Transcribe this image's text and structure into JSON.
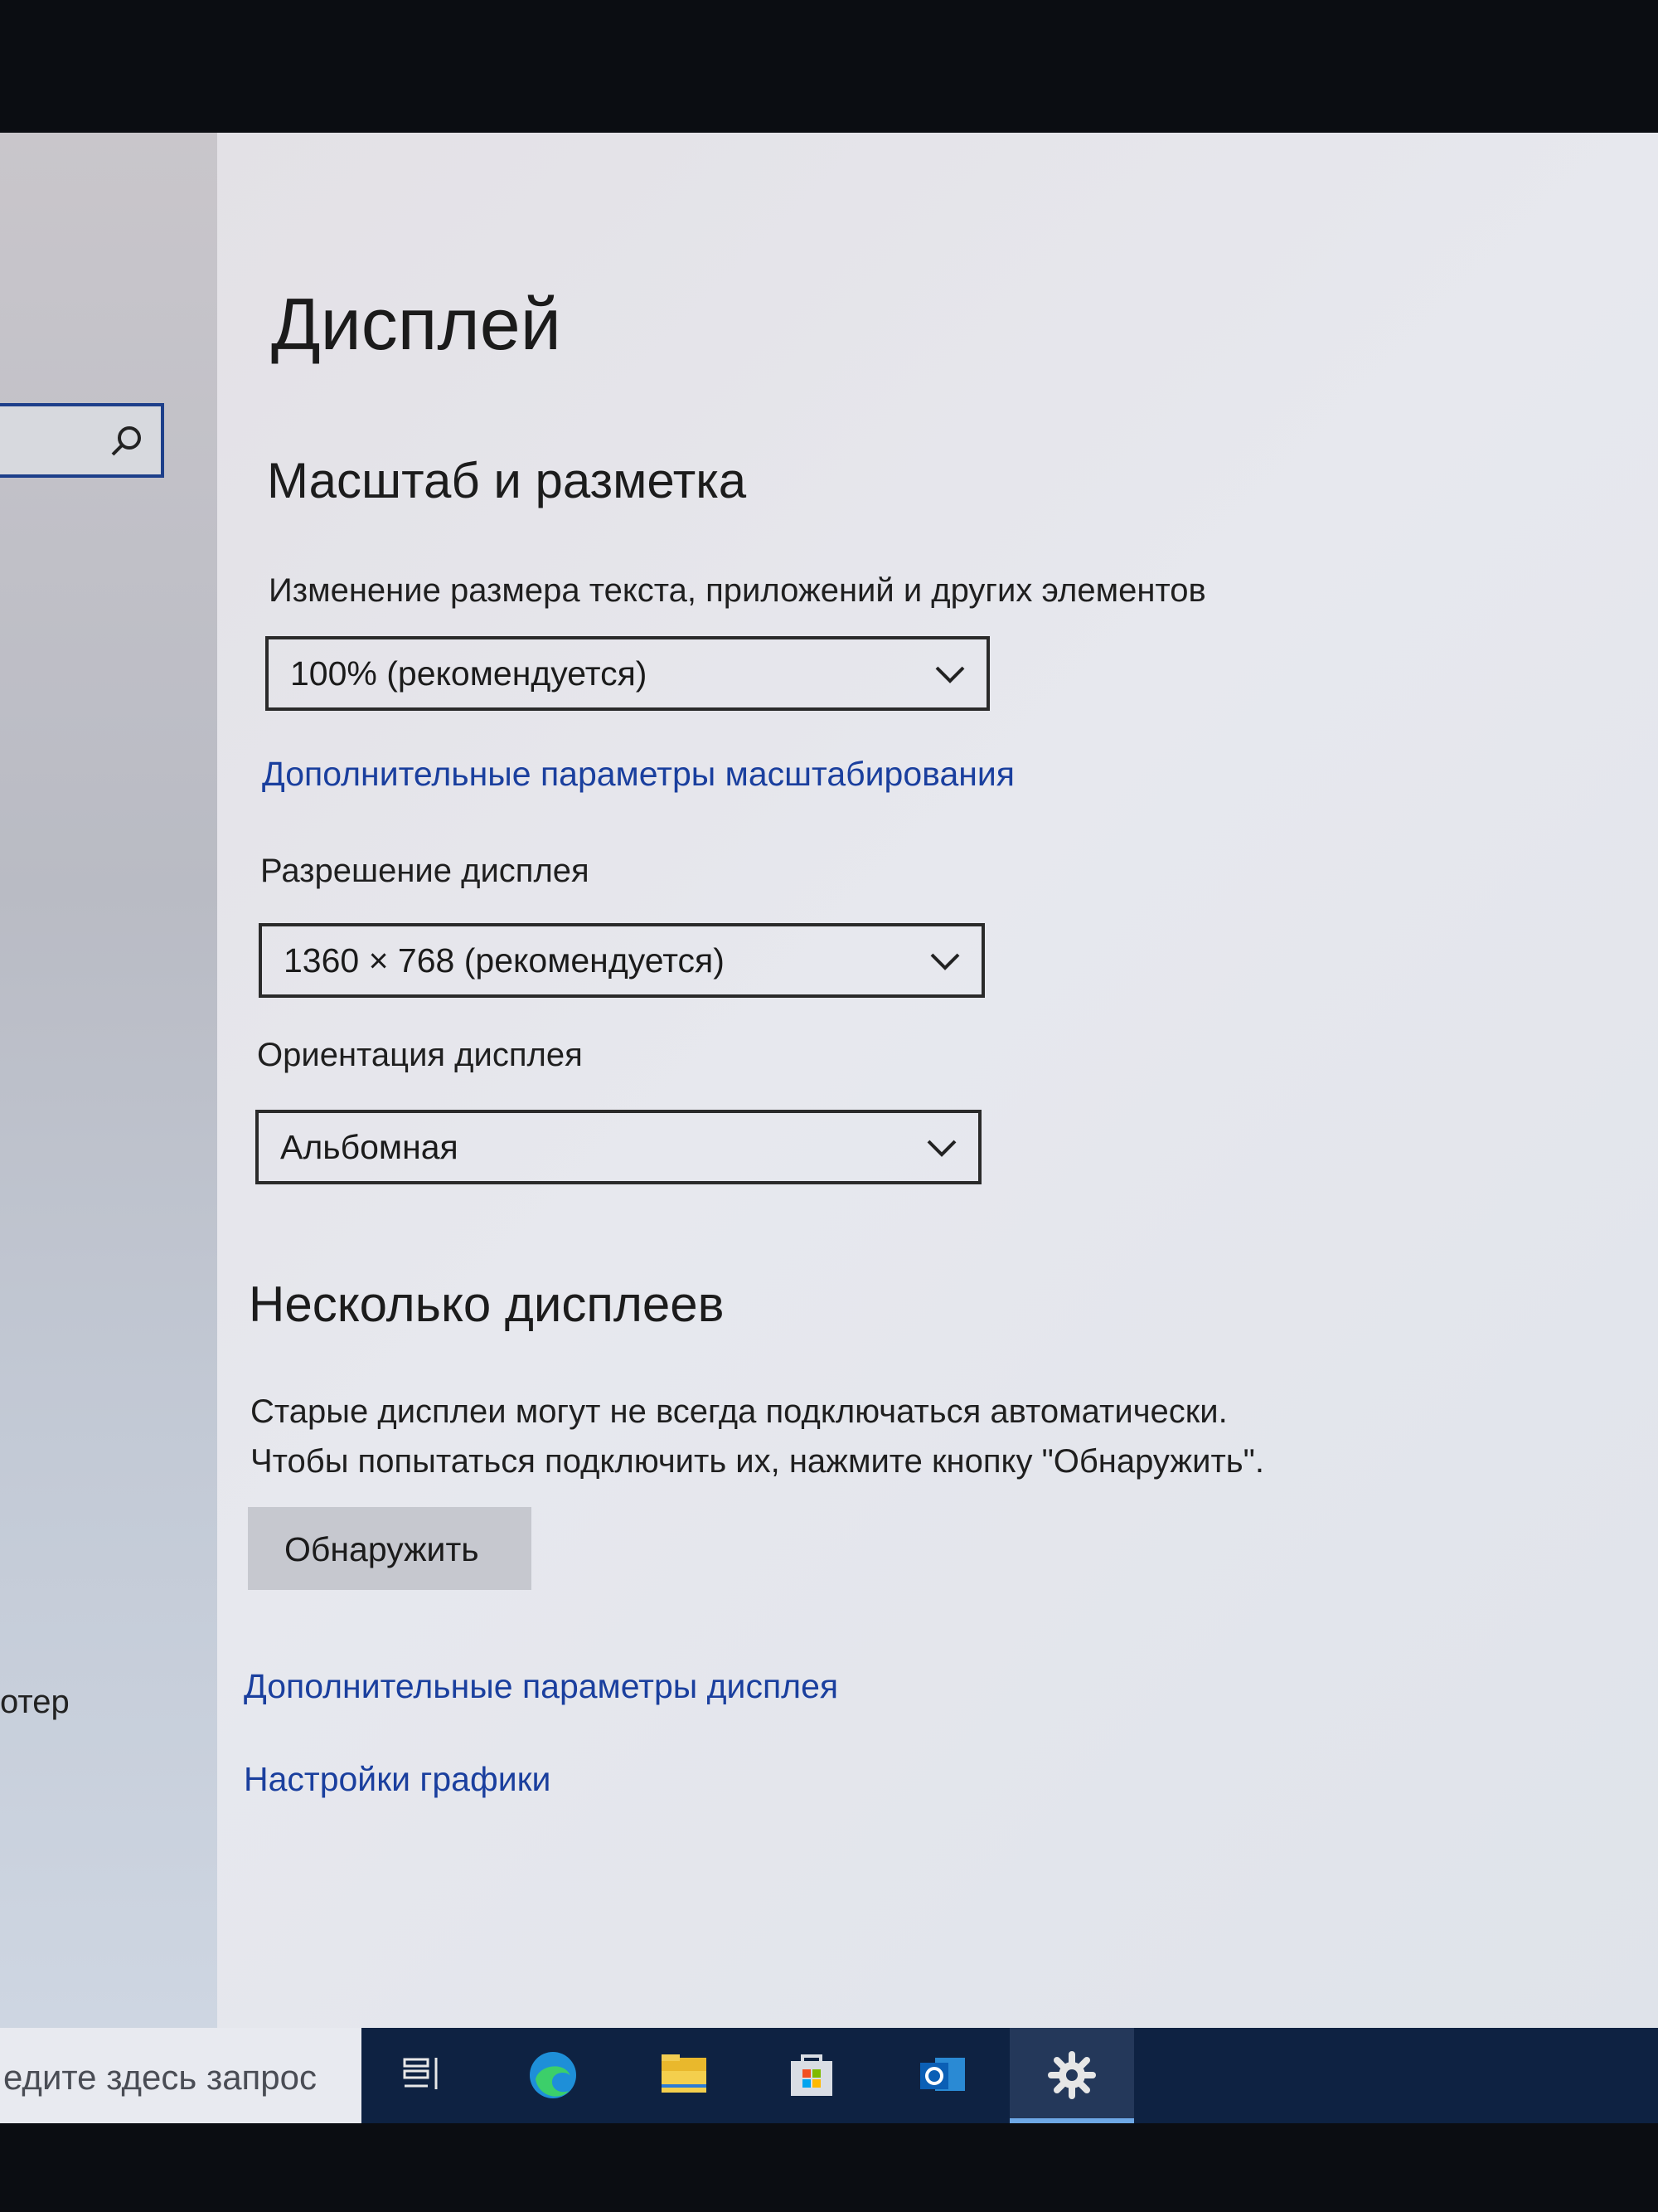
{
  "window": {
    "page_title": "Дисплей"
  },
  "sidebar": {
    "search_icon": "search-icon",
    "partial_item_label": "отер"
  },
  "scale_section": {
    "heading": "Масштаб и разметка",
    "size_label": "Изменение размера текста, приложений и других элементов",
    "size_value": "100% (рекомендуется)",
    "advanced_scaling_link": "Дополнительные параметры масштабирования",
    "resolution_label": "Разрешение дисплея",
    "resolution_value": "1360 × 768 (рекомендуется)",
    "orientation_label": "Ориентация дисплея",
    "orientation_value": "Альбомная"
  },
  "multi_section": {
    "heading": "Несколько дисплеев",
    "description_line1": "Старые дисплеи могут не всегда подключаться автоматически.",
    "description_line2": "Чтобы попытаться подключить их, нажмите кнопку \"Обнаружить\".",
    "detect_button": "Обнаружить"
  },
  "links": {
    "advanced_display": "Дополнительные параметры дисплея",
    "graphics_settings": "Настройки графики"
  },
  "taskbar": {
    "search_placeholder": "едите здесь запрос",
    "icons": [
      "task-view-icon",
      "edge-icon",
      "file-explorer-icon",
      "store-icon",
      "outlook-icon",
      "settings-icon"
    ],
    "active_app": "settings-icon"
  },
  "colors": {
    "link": "#1a3f9e",
    "taskbar": "#0e2242",
    "accent": "#6ea8e6"
  }
}
